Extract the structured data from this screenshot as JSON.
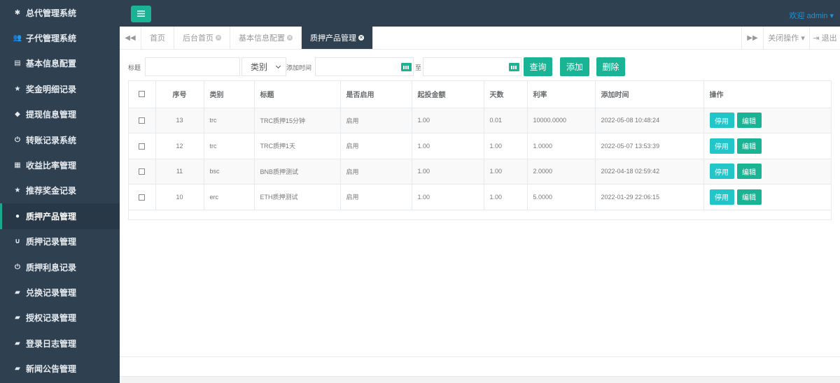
{
  "sidebar": {
    "items": [
      {
        "label": "总代管理系统",
        "icon": "gear-icon",
        "glyph": "✱",
        "active": false
      },
      {
        "label": "子代管理系统",
        "icon": "users-icon",
        "glyph": "👥",
        "active": false
      },
      {
        "label": "基本信息配置",
        "icon": "document-icon",
        "glyph": "▤",
        "active": false
      },
      {
        "label": "奖金明细记录",
        "icon": "star-icon",
        "glyph": "★",
        "active": false
      },
      {
        "label": "提现信息管理",
        "icon": "tag-icon",
        "glyph": "◆",
        "active": false
      },
      {
        "label": "转账记录系统",
        "icon": "power-icon",
        "glyph": "⏻",
        "active": false
      },
      {
        "label": "收益比率管理",
        "icon": "calendar-icon",
        "glyph": "▦",
        "active": false
      },
      {
        "label": "推荐奖金记录",
        "icon": "star-icon",
        "glyph": "★",
        "active": false
      },
      {
        "label": "质押产品管理",
        "icon": "comment-icon",
        "glyph": "●",
        "active": true
      },
      {
        "label": "质押记录管理",
        "icon": "magnet-icon",
        "glyph": "∪",
        "active": false
      },
      {
        "label": "质押利息记录",
        "icon": "power-icon",
        "glyph": "⏻",
        "active": false
      },
      {
        "label": "兑换记录管理",
        "icon": "book-icon",
        "glyph": "▰",
        "active": false
      },
      {
        "label": "授权记录管理",
        "icon": "book-icon",
        "glyph": "▰",
        "active": false
      },
      {
        "label": "登录日志管理",
        "icon": "book-icon",
        "glyph": "▰",
        "active": false
      },
      {
        "label": "新闻公告管理",
        "icon": "book-icon",
        "glyph": "▰",
        "active": false
      }
    ]
  },
  "header": {
    "welcome": "欢迎 admin ▾"
  },
  "tabbar": {
    "prev_glyph": "◀◀",
    "next_glyph": "▶▶",
    "tabs": [
      {
        "label": "首页",
        "closable": false,
        "active": false
      },
      {
        "label": "后台首页",
        "closable": true,
        "active": false
      },
      {
        "label": "基本信息配置",
        "closable": true,
        "active": false
      },
      {
        "label": "质押产品管理",
        "closable": true,
        "active": true
      }
    ],
    "close_ops": "关闭操作 ▾",
    "logout": "⇥ 退出"
  },
  "search": {
    "title_label": "标题",
    "title_value": "",
    "type_value": "类别",
    "time_label": "添加时间",
    "to_label": "至",
    "query_button": "查询",
    "add_button": "添加",
    "delete_button": "删除"
  },
  "table": {
    "headers": [
      "",
      "序号",
      "类别",
      "标题",
      "是否启用",
      "起投金额",
      "天数",
      "利率",
      "添加时间",
      "操作"
    ],
    "rows": [
      {
        "id": "13",
        "type": "trc",
        "title": "TRC质押15分钟",
        "enabled": "启用",
        "min_amount": "1.00",
        "days": "0.01",
        "rate": "10000.0000",
        "added": "2022-05-08 10:48:24"
      },
      {
        "id": "12",
        "type": "trc",
        "title": "TRC质押1天",
        "enabled": "启用",
        "min_amount": "1.00",
        "days": "1.00",
        "rate": "1.0000",
        "added": "2022-05-07 13:53:39"
      },
      {
        "id": "11",
        "type": "bsc",
        "title": "BNB质押测试",
        "enabled": "启用",
        "min_amount": "1.00",
        "days": "1.00",
        "rate": "2.0000",
        "added": "2022-04-18 02:59:42"
      },
      {
        "id": "10",
        "type": "erc",
        "title": "ETH质押测试",
        "enabled": "启用",
        "min_amount": "1.00",
        "days": "1.00",
        "rate": "5.0000",
        "added": "2022-01-29 22:06:15"
      }
    ],
    "disable_label": "停用",
    "edit_label": "编辑"
  },
  "colors": {
    "sidebar_bg": "#2f4050",
    "primary": "#1ab394",
    "info": "#23c6c8",
    "link": "#1e93d6"
  }
}
